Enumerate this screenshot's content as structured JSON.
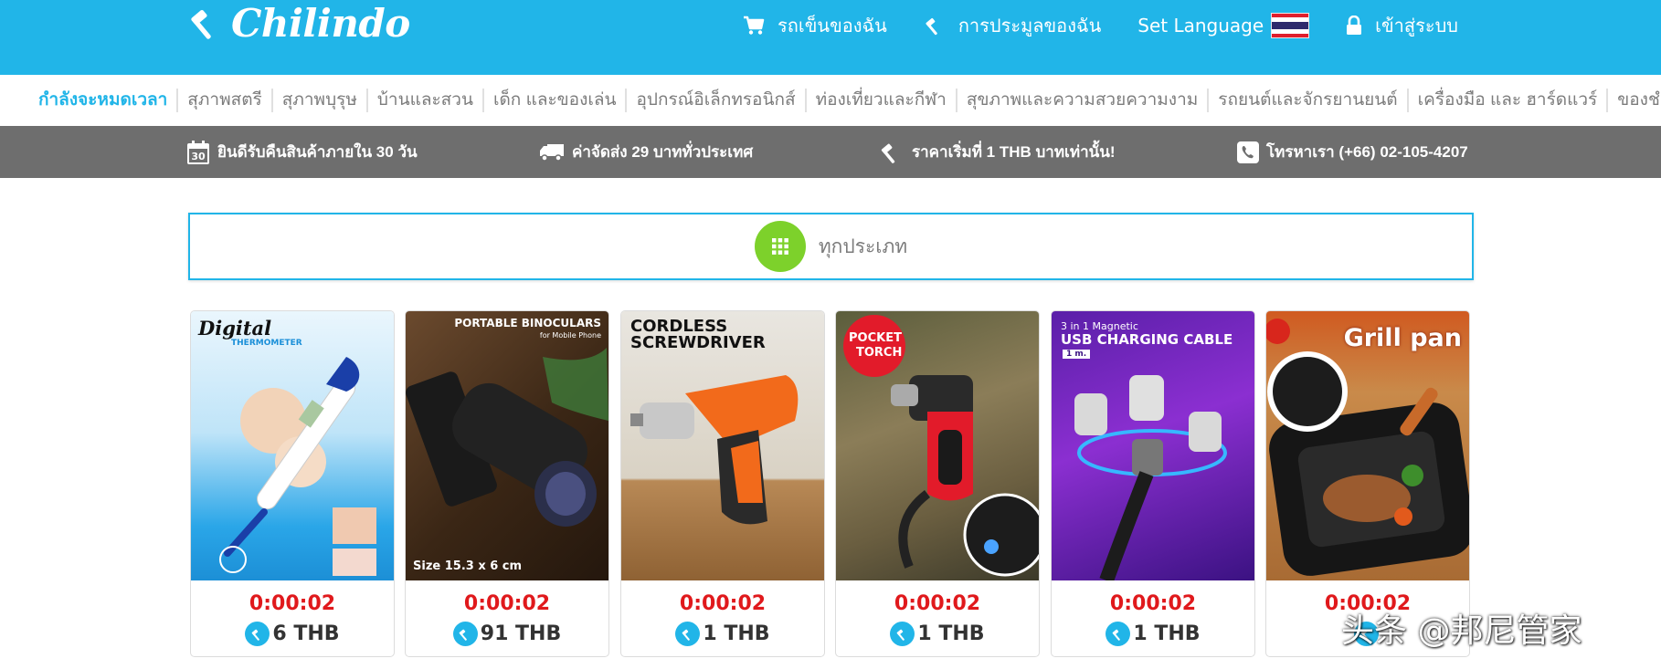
{
  "brand": {
    "name": "Chilindo"
  },
  "topnav": {
    "cart": "รถเข็นของฉัน",
    "auctions": "การประมูลของฉัน",
    "language": "Set Language",
    "login": "เข้าสู่ระบบ"
  },
  "categories": [
    "กำลังจะหมดเวลา",
    "สุภาพสตรี",
    "สุภาพบุรุษ",
    "บ้านและสวน",
    "เด็ก และของเล่น",
    "อุปกรณ์อิเล็กทรอนิกส์",
    "ท่องเที่ยวและกีฬา",
    "สุขภาพและความสวยความงาม",
    "รถยนต์และจักรยานยนต์",
    "เครื่องมือ และ ฮาร์ดแวร์",
    "ของชำ"
  ],
  "info": {
    "calendar_day": "30",
    "returns": "ยินดีรับคืนสินค้าภายใน 30 วัน",
    "shipping": "ค่าจัดส่ง 29 บาททั่วประเทศ",
    "price_from": "ราคาเริ่มที่ 1 THB บาทเท่านั้น!",
    "phone": "โทรหาเรา (+66) 02-105-4207"
  },
  "selector": {
    "label": "ทุกประเภท"
  },
  "products": [
    {
      "image_text": [
        "Digital",
        "THERMOMETER"
      ],
      "timer": "0:00:02",
      "price": "6 THB"
    },
    {
      "image_text": [
        "PORTABLE BINOCULARS",
        "for Mobile Phone",
        "Size 15.3 x 6 cm"
      ],
      "timer": "0:00:02",
      "price": "91 THB"
    },
    {
      "image_text": [
        "CORDLESS",
        "SCREWDRIVER"
      ],
      "timer": "0:00:02",
      "price": "1 THB"
    },
    {
      "image_text": [
        "POCKET",
        "TORCH"
      ],
      "timer": "0:00:02",
      "price": "1 THB"
    },
    {
      "image_text": [
        "3 in 1 Magnetic",
        "USB CHARGING CABLE",
        "1 m."
      ],
      "timer": "0:00:02",
      "price": "1 THB"
    },
    {
      "image_text": [
        "Grill pan"
      ],
      "timer": "0:00:02",
      "price": ""
    }
  ],
  "watermark": "头条 @邦尼管家",
  "colors": {
    "primary": "#21b5e8",
    "timer": "#e0191c",
    "info_bg": "#6e6e6e",
    "grid_button": "#7dd12b"
  }
}
